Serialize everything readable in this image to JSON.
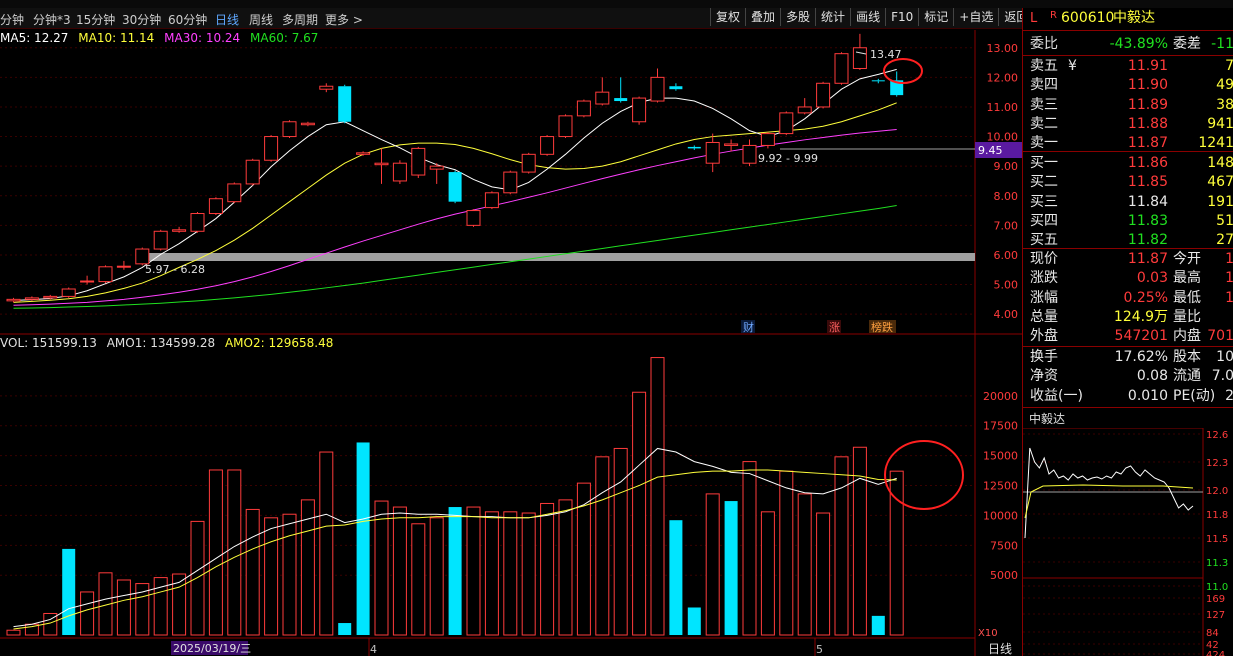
{
  "toolbar": {
    "periods": [
      "分钟",
      "分钟*3",
      "15分钟",
      "30分钟",
      "60分钟",
      "日线",
      "周线",
      "多周期",
      "更多 >"
    ],
    "active_period": "日线",
    "right_buttons": [
      "复权",
      "叠加",
      "多股",
      "统计",
      "画线",
      "F10",
      "标记",
      "+自选",
      "返回"
    ]
  },
  "ma_legend": {
    "ma5": "MA5: 12.27",
    "ma10": "MA10: 11.14",
    "ma30": "MA30: 10.24",
    "ma60": "MA60: 7.67",
    "colors": {
      "ma5": "#ffffff",
      "ma10": "#ffff3b",
      "ma30": "#ff40ff",
      "ma60": "#20e020"
    }
  },
  "vol_legend": {
    "vol": "VOL: 151599.13",
    "amo1": "AMO1: 134599.28",
    "amo2": "AMO2: 129658.48"
  },
  "chart_annotations": {
    "high_label": "13.47",
    "range_label_1": "9.92 - 9.99",
    "range_label_2": "5.97 - 6.28",
    "current_price_tag": "9.45",
    "badges": [
      "财",
      "涨",
      "榜跌"
    ],
    "date_label": "2025/03/19/三",
    "month_label_4": "4",
    "month_label_5": "5",
    "vol_unit": "X10",
    "period_tab": "日线"
  },
  "chart_data": [
    {
      "type": "candlestick",
      "y_ticks": [
        "13.00",
        "12.00",
        "11.00",
        "10.00",
        "9.00",
        "8.00",
        "7.00",
        "6.00",
        "5.00",
        "4.00"
      ],
      "ylim": [
        3.6,
        13.6
      ],
      "candles": [
        [
          4.45,
          4.5,
          4.4,
          4.55
        ],
        [
          4.5,
          4.55,
          4.45,
          4.6
        ],
        [
          4.55,
          4.6,
          4.5,
          4.65
        ],
        [
          4.6,
          4.85,
          4.55,
          4.9
        ],
        [
          5.1,
          5.12,
          5.0,
          5.3
        ],
        [
          5.1,
          5.6,
          5.05,
          5.65
        ],
        [
          5.6,
          5.62,
          5.5,
          5.8
        ],
        [
          5.7,
          6.2,
          5.65,
          6.25
        ],
        [
          6.2,
          6.8,
          6.15,
          6.85
        ],
        [
          6.8,
          6.85,
          6.75,
          6.95
        ],
        [
          6.8,
          7.4,
          6.75,
          7.45
        ],
        [
          7.4,
          7.9,
          7.35,
          7.95
        ],
        [
          7.8,
          8.4,
          7.75,
          8.45
        ],
        [
          8.4,
          9.2,
          8.35,
          9.25
        ],
        [
          9.2,
          10.0,
          9.15,
          10.05
        ],
        [
          10.0,
          10.5,
          9.95,
          10.55
        ],
        [
          10.4,
          10.45,
          10.35,
          10.5
        ],
        [
          11.6,
          11.7,
          11.5,
          11.8
        ],
        [
          11.7,
          10.5,
          10.45,
          11.75
        ],
        [
          9.4,
          9.45,
          9.35,
          9.5
        ],
        [
          9.05,
          9.1,
          8.4,
          9.6
        ],
        [
          8.5,
          9.1,
          8.4,
          9.2
        ],
        [
          8.7,
          9.6,
          8.6,
          9.65
        ],
        [
          8.9,
          9.0,
          8.4,
          9.1
        ],
        [
          8.8,
          7.8,
          7.75,
          8.85
        ],
        [
          7.0,
          7.5,
          6.95,
          7.55
        ],
        [
          7.6,
          8.1,
          7.55,
          8.15
        ],
        [
          8.1,
          8.8,
          8.05,
          8.85
        ],
        [
          8.8,
          9.4,
          8.75,
          9.45
        ],
        [
          9.4,
          10.0,
          9.35,
          10.05
        ],
        [
          10.0,
          10.7,
          9.95,
          10.75
        ],
        [
          10.7,
          11.2,
          10.65,
          11.25
        ],
        [
          11.1,
          11.5,
          11.05,
          12.0
        ],
        [
          11.3,
          11.2,
          11.15,
          12.0
        ],
        [
          10.5,
          11.3,
          10.4,
          11.35
        ],
        [
          11.2,
          12.0,
          11.15,
          12.3
        ],
        [
          11.7,
          11.6,
          11.55,
          11.8
        ],
        [
          9.65,
          9.6,
          9.55,
          9.7
        ],
        [
          9.1,
          9.8,
          8.8,
          10.1
        ],
        [
          9.7,
          9.75,
          9.5,
          9.9
        ],
        [
          9.1,
          9.7,
          9.0,
          9.9
        ],
        [
          9.7,
          10.1,
          9.6,
          10.15
        ],
        [
          10.1,
          10.8,
          10.05,
          10.85
        ],
        [
          10.8,
          11.0,
          10.75,
          11.3
        ],
        [
          11.0,
          11.8,
          10.95,
          11.85
        ],
        [
          11.8,
          12.8,
          11.75,
          12.85
        ],
        [
          12.3,
          13.0,
          12.25,
          13.47
        ],
        [
          11.9,
          11.87,
          11.8,
          11.95
        ],
        [
          11.9,
          11.4,
          11.35,
          12.2
        ]
      ],
      "ma5": [
        4.46,
        4.49,
        4.53,
        4.62,
        4.79,
        5.03,
        5.26,
        5.58,
        6.02,
        6.38,
        6.8,
        7.23,
        7.78,
        8.35,
        8.98,
        9.52,
        10.0,
        10.4,
        10.5,
        10.2,
        9.9,
        9.62,
        9.3,
        9.05,
        8.88,
        8.55,
        8.3,
        8.2,
        8.45,
        8.9,
        9.4,
        9.95,
        10.45,
        10.85,
        11.15,
        11.3,
        11.3,
        11.2,
        10.95,
        10.6,
        10.2,
        10.0,
        10.2,
        10.6,
        11.1,
        11.6,
        11.95,
        12.1,
        12.27
      ],
      "ma10": [
        4.4,
        4.43,
        4.47,
        4.52,
        4.6,
        4.72,
        4.87,
        5.05,
        5.3,
        5.58,
        5.85,
        6.15,
        6.5,
        6.9,
        7.35,
        7.8,
        8.25,
        8.7,
        9.1,
        9.4,
        9.6,
        9.72,
        9.78,
        9.78,
        9.73,
        9.6,
        9.42,
        9.22,
        9.05,
        8.95,
        8.9,
        8.92,
        9.0,
        9.15,
        9.35,
        9.55,
        9.75,
        9.9,
        10.0,
        10.05,
        10.1,
        10.15,
        10.2,
        10.25,
        10.35,
        10.5,
        10.7,
        10.9,
        11.14
      ],
      "ma30": [
        4.3,
        4.32,
        4.34,
        4.37,
        4.4,
        4.45,
        4.5,
        4.57,
        4.65,
        4.74,
        4.84,
        4.96,
        5.1,
        5.26,
        5.44,
        5.64,
        5.85,
        6.06,
        6.27,
        6.47,
        6.66,
        6.85,
        7.04,
        7.22,
        7.38,
        7.52,
        7.66,
        7.8,
        7.95,
        8.1,
        8.26,
        8.42,
        8.58,
        8.73,
        8.88,
        9.02,
        9.15,
        9.28,
        9.4,
        9.51,
        9.61,
        9.71,
        9.8,
        9.89,
        9.97,
        10.05,
        10.12,
        10.18,
        10.24
      ],
      "ma60": [
        4.2,
        4.21,
        4.22,
        4.24,
        4.26,
        4.28,
        4.31,
        4.34,
        4.37,
        4.41,
        4.45,
        4.5,
        4.55,
        4.61,
        4.67,
        4.74,
        4.81,
        4.89,
        4.97,
        5.05,
        5.14,
        5.23,
        5.32,
        5.41,
        5.5,
        5.59,
        5.68,
        5.77,
        5.86,
        5.95,
        6.04,
        6.13,
        6.22,
        6.31,
        6.4,
        6.49,
        6.58,
        6.67,
        6.76,
        6.85,
        6.94,
        7.03,
        7.12,
        7.21,
        7.3,
        7.39,
        7.48,
        7.57,
        7.67
      ]
    },
    {
      "type": "bar",
      "y_ticks": [
        "20000",
        "17500",
        "15000",
        "12500",
        "10000",
        "7500",
        "5000"
      ],
      "ylim": [
        0,
        24000
      ],
      "volumes": [
        400,
        900,
        1800,
        7200,
        3600,
        5200,
        4600,
        4300,
        4800,
        5100,
        9500,
        13800,
        13800,
        10500,
        9800,
        10100,
        11300,
        15300,
        1000,
        16100,
        11200,
        10700,
        9300,
        9800,
        10700,
        10700,
        10300,
        10300,
        10200,
        11000,
        11300,
        12700,
        14900,
        15600,
        20300,
        23200,
        9600,
        2300,
        11800,
        11200,
        14500,
        10300,
        13700,
        11800,
        10200,
        14900,
        15700,
        1600,
        13700
      ],
      "up": [
        true,
        true,
        true,
        false,
        true,
        true,
        true,
        true,
        true,
        true,
        true,
        true,
        true,
        true,
        true,
        true,
        true,
        true,
        false,
        false,
        true,
        true,
        true,
        true,
        false,
        true,
        true,
        true,
        true,
        true,
        true,
        true,
        true,
        true,
        true,
        true,
        false,
        false,
        true,
        false,
        true,
        true,
        true,
        true,
        true,
        true,
        true,
        false,
        true
      ],
      "amo1": [
        700,
        900,
        1300,
        2200,
        2600,
        3000,
        3300,
        3600,
        4000,
        4400,
        5400,
        6400,
        7400,
        8200,
        8900,
        9300,
        9700,
        10100,
        9400,
        9700,
        10100,
        10200,
        10100,
        10100,
        10000,
        9900,
        9900,
        9800,
        9800,
        10000,
        10300,
        10900,
        11900,
        12800,
        14200,
        15600,
        15300,
        14500,
        14100,
        13600,
        13500,
        12900,
        12300,
        11900,
        11800,
        12300,
        13100,
        12600,
        13100
      ],
      "amo2": [
        500,
        700,
        1000,
        1600,
        2100,
        2500,
        2900,
        3200,
        3600,
        4000,
        4800,
        5700,
        6500,
        7200,
        7800,
        8300,
        8700,
        9100,
        9200,
        9500,
        9700,
        9800,
        9800,
        9900,
        9900,
        9900,
        9800,
        9800,
        9800,
        10100,
        10400,
        10800,
        11300,
        11900,
        12500,
        13200,
        13400,
        13600,
        13700,
        13700,
        13800,
        13800,
        13700,
        13600,
        13500,
        13400,
        13300,
        13000,
        12966
      ]
    }
  ],
  "right_panel": {
    "code": "600610",
    "name": "中毅达",
    "marker_l": "L",
    "marker_r": "R",
    "weibi_label": "委比",
    "weibi_value": "-43.89%",
    "weicha_label": "委差",
    "weicha_value": "-11",
    "asks": [
      {
        "label": "卖五",
        "yen": "¥",
        "price": "11.91",
        "vol": "7"
      },
      {
        "label": "卖四",
        "yen": "",
        "price": "11.90",
        "vol": "49"
      },
      {
        "label": "卖三",
        "yen": "",
        "price": "11.89",
        "vol": "38"
      },
      {
        "label": "卖二",
        "yen": "",
        "price": "11.88",
        "vol": "941"
      },
      {
        "label": "卖一",
        "yen": "",
        "price": "11.87",
        "vol": "1241"
      }
    ],
    "bids": [
      {
        "label": "买一",
        "price": "11.86",
        "vol": "148"
      },
      {
        "label": "买二",
        "price": "11.85",
        "vol": "467"
      },
      {
        "label": "买三",
        "price": "11.84",
        "vol": "191"
      },
      {
        "label": "买四",
        "price": "11.83",
        "vol": "51"
      },
      {
        "label": "买五",
        "price": "11.82",
        "vol": "27"
      }
    ],
    "stats": [
      {
        "l1": "现价",
        "v1": "11.87",
        "l2": "今开",
        "v2": "1"
      },
      {
        "l1": "涨跌",
        "v1": "0.03",
        "l2": "最高",
        "v2": "1"
      },
      {
        "l1": "涨幅",
        "v1": "0.25%",
        "l2": "最低",
        "v2": "1"
      },
      {
        "l1": "总量",
        "v1": "124.9万",
        "l2": "量比",
        "v2": ""
      },
      {
        "l1": "外盘",
        "v1": "547201",
        "l2": "内盘",
        "v2": "701"
      }
    ],
    "stats2": [
      {
        "l1": "换手",
        "v1": "17.62%",
        "l2": "股本",
        "v2": "10"
      },
      {
        "l1": "净资",
        "v1": "0.08",
        "l2": "流通",
        "v2": "7.0"
      },
      {
        "l1": "收益(一)",
        "v1": "0.010",
        "l2": "PE(动)",
        "v2": "2"
      }
    ],
    "mini_title": "中毅达",
    "mini_ticks": [
      "12.6",
      "12.3",
      "12.0",
      "11.8",
      "11.5",
      "11.3",
      "11.0",
      "169",
      "127",
      "84",
      "42",
      "424"
    ]
  }
}
